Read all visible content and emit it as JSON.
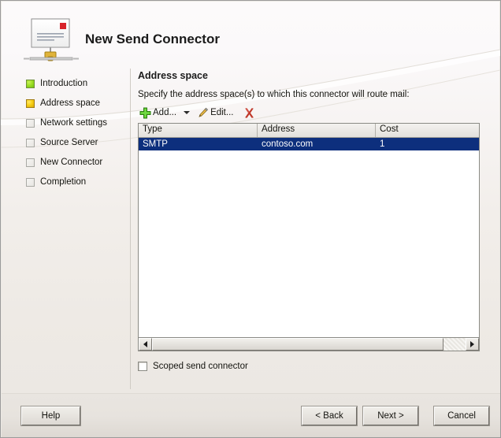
{
  "window": {
    "title": "New Send Connector",
    "icon": "send-connector-icon"
  },
  "steps": [
    {
      "label": "Introduction",
      "state": "done",
      "icon": "step-complete-icon"
    },
    {
      "label": "Address space",
      "state": "current",
      "icon": "step-current-icon"
    },
    {
      "label": "Network settings",
      "state": "todo",
      "icon": "step-pending-icon"
    },
    {
      "label": "Source Server",
      "state": "todo",
      "icon": "step-pending-icon"
    },
    {
      "label": "New Connector",
      "state": "todo",
      "icon": "step-pending-icon"
    },
    {
      "label": "Completion",
      "state": "todo",
      "icon": "step-pending-icon"
    }
  ],
  "content": {
    "heading": "Address space",
    "instruction": "Specify the address space(s) to which this connector will route mail:"
  },
  "toolbar": {
    "add_label": "Add...",
    "add_icon": "plus-icon",
    "add_dropdown_icon": "chevron-down-icon",
    "edit_label": "Edit...",
    "edit_icon": "pencil-icon",
    "delete_icon": "red-x-delete-icon"
  },
  "table": {
    "columns": [
      "Type",
      "Address",
      "Cost"
    ],
    "rows": [
      {
        "type": "SMTP",
        "address": "contoso.com",
        "cost": "1",
        "selected": true
      }
    ]
  },
  "scrollbar": {
    "left_arrow_icon": "scroll-left-arrow-icon",
    "right_arrow_icon": "scroll-right-arrow-icon"
  },
  "options": {
    "scoped_label": "Scoped send connector",
    "scoped_checked": false
  },
  "buttons": {
    "help": "Help",
    "back": "< Back",
    "next": "Next >",
    "cancel": "Cancel"
  },
  "colors": {
    "selection_blue": "#0d2f7d",
    "step_done_green": "#9ede25",
    "step_current_yellow": "#f7cf15",
    "delete_red": "#c0392b",
    "dialog_face": "#ece9e4"
  }
}
